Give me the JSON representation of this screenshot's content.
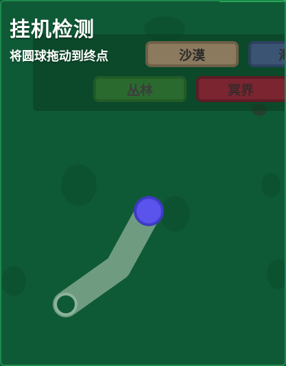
{
  "captcha": {
    "title": "挂机检测",
    "instruction": "将圆球拖动到终点"
  },
  "biomes": {
    "desert": "沙漠",
    "ocean": "海",
    "jungle": "丛林",
    "underworld": "冥界"
  },
  "colors": {
    "background": "#0f5a36",
    "path": "#6f9c80",
    "ball": "#5a53ec",
    "ball_ring": "#3f3bc4",
    "goal_ring": "#7fa58c"
  }
}
